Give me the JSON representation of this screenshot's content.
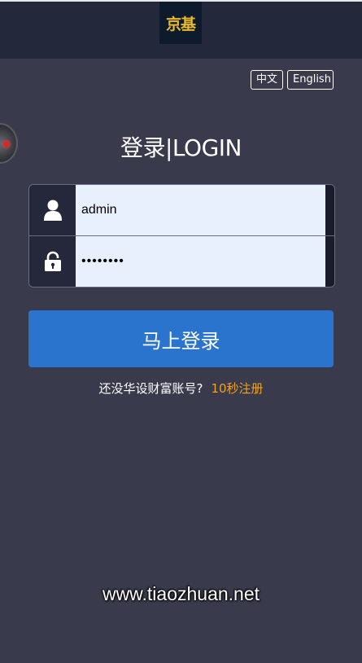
{
  "header": {
    "logo_text": "京基"
  },
  "language": {
    "zh_label": "中文",
    "en_label": "English"
  },
  "login": {
    "title": "登录|LOGIN",
    "username_value": "admin",
    "password_value": "••••••••",
    "submit_label": "马上登录"
  },
  "register": {
    "question": "还没华设财富账号?",
    "link_label": "10秒注册"
  },
  "watermark": {
    "text": "www.tiaozhuan.net"
  },
  "colors": {
    "background": "#393a4c",
    "header": "#23283a",
    "primary_button": "#2b74ce",
    "register_link": "#f4a21c",
    "logo_text": "#e8b92c"
  },
  "icons": {
    "user": "user-icon",
    "password": "lock-icon"
  }
}
